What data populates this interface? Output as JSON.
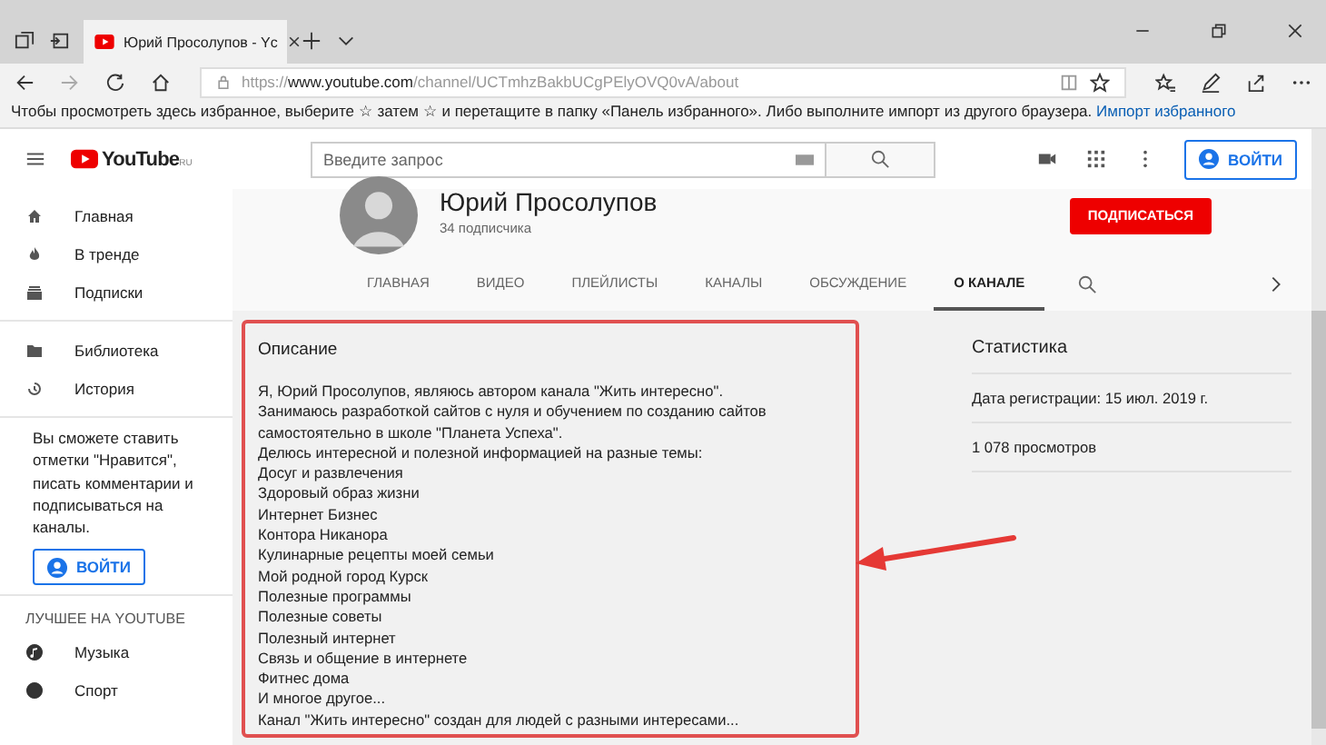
{
  "browser": {
    "tab": {
      "title": "Юрий Просолупов - Yc"
    },
    "address": {
      "prefix": "https://",
      "domain": "www.youtube.com",
      "path": "/channel/UCTmhzBakbUCgPElyOVQ0vA/about"
    },
    "favorites_bar": {
      "message": "Чтобы просмотреть здесь избранное, выберите ☆ затем ☆ и перетащите в папку «Панель избранного». Либо выполните импорт из другого браузера.",
      "link": "Импорт избранного"
    }
  },
  "header": {
    "logo": "YouTube",
    "logo_region": "RU",
    "search": {
      "placeholder": "Введите запрос"
    },
    "sign_in": "ВОЙТИ"
  },
  "sidebar": {
    "main": [
      {
        "kind": "home",
        "label": "Главная"
      },
      {
        "kind": "trending",
        "label": "В тренде"
      },
      {
        "kind": "subscriptions",
        "label": "Подписки"
      }
    ],
    "library": [
      {
        "kind": "library",
        "label": "Библиотека"
      },
      {
        "kind": "history",
        "label": "История"
      }
    ],
    "promo": "Вы сможете ставить отметки \"Нравится\", писать комментарии и подписываться на каналы.",
    "sign_in": "ВОЙТИ",
    "best_heading": "ЛУЧШЕЕ НА YOUTUBE",
    "best": [
      {
        "kind": "music",
        "label": "Музыка"
      },
      {
        "kind": "sport",
        "label": "Спорт"
      }
    ]
  },
  "channel": {
    "name": "Юрий Просолупов",
    "subscribers": "34 подписчика",
    "subscribe": "ПОДПИСАТЬСЯ",
    "tabs": [
      {
        "label": "ГЛАВНАЯ",
        "selected": false
      },
      {
        "label": "ВИДЕО",
        "selected": false
      },
      {
        "label": "ПЛЕЙЛИСТЫ",
        "selected": false
      },
      {
        "label": "КАНАЛЫ",
        "selected": false
      },
      {
        "label": "ОБСУЖДЕНИЕ",
        "selected": false
      },
      {
        "label": "О КАНАЛЕ",
        "selected": true
      }
    ]
  },
  "about": {
    "description_title": "Описание",
    "description": [
      "Я, Юрий Просолупов, являюсь автором  канала \"Жить интересно\".",
      "Занимаюсь разработкой сайтов с нуля и обучением по созданию сайтов самостоятельно в школе \"Планета Успеха\".",
      "Делюсь интересной и полезной информацией на разные темы:",
      "Досуг и развлечения",
      "Здоровый образ жизни",
      "Интернет Бизнес",
      "Контора Никанора",
      "Кулинарные рецепты моей семьи",
      "Мой родной город Курск",
      "Полезные программы",
      "Полезные советы",
      "Полезный интернет",
      "Связь и общение в интернете",
      "Фитнес дома",
      "И многое другое...",
      "Канал \"Жить интересно\" создан для людей с разными интересами..."
    ],
    "stats_title": "Статистика",
    "stats": [
      "Дата регистрации: 15 июл. 2019 г.",
      "1 078 просмотров"
    ]
  }
}
